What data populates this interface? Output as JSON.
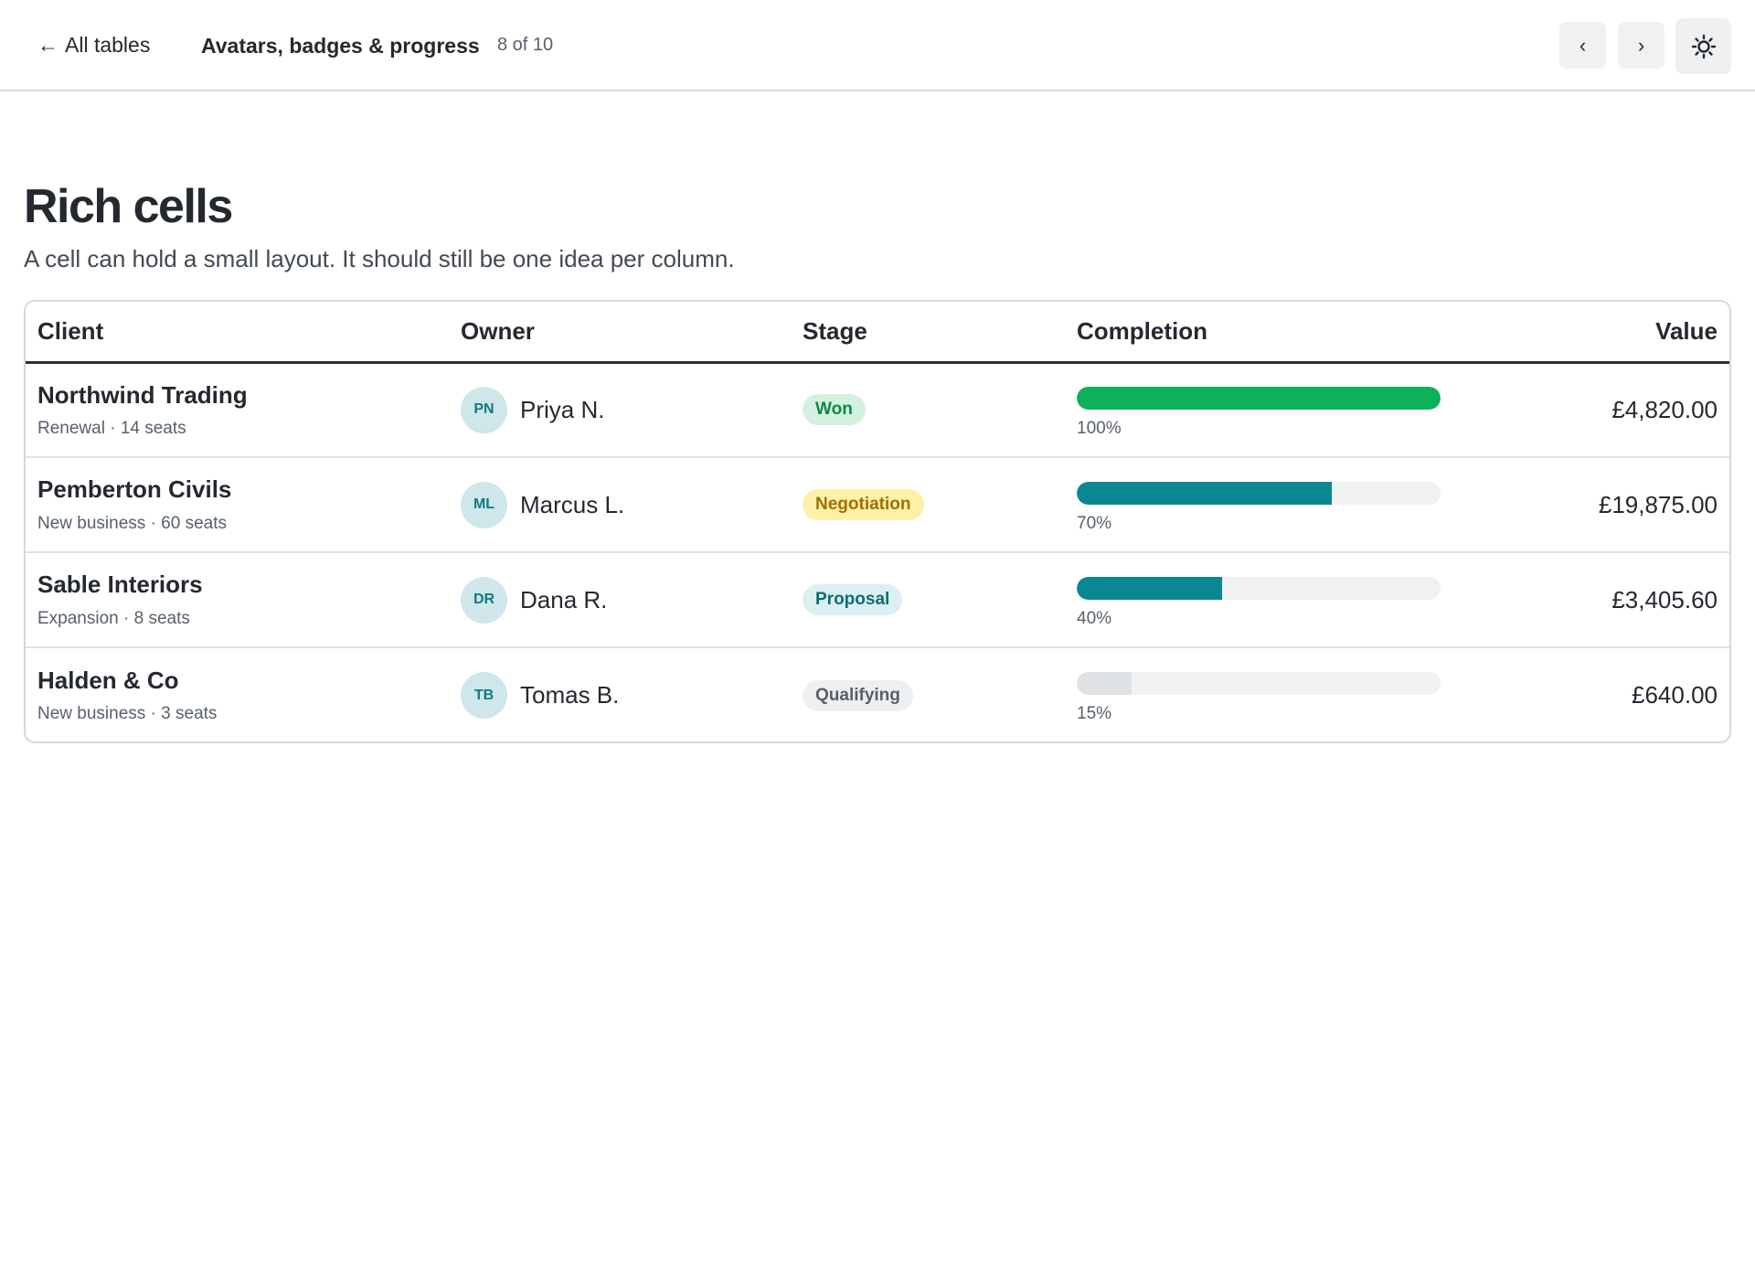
{
  "header": {
    "back_label": "All tables",
    "section_title": "Avatars, badges & progress",
    "position": "8 of 10",
    "prev_label": "‹",
    "next_label": "›"
  },
  "page": {
    "title": "Rich cells",
    "subtitle": "A cell can hold a small layout. It should still be one idea per column."
  },
  "table": {
    "columns": [
      "Client",
      "Owner",
      "Stage",
      "Completion",
      "Value"
    ],
    "rows": [
      {
        "client": "Northwind Trading",
        "meta": "Renewal · 14 seats",
        "initials": "PN",
        "owner": "Priya N.",
        "stage": "Won",
        "stage_bg": "#d4f1df",
        "stage_fg": "#0b8a44",
        "completion": 100,
        "completion_label": "100%",
        "bar_color": "#0db15a",
        "value": "£4,820.00"
      },
      {
        "client": "Pemberton Civils",
        "meta": "New business · 60 seats",
        "initials": "ML",
        "owner": "Marcus L.",
        "stage": "Negotiation",
        "stage_bg": "#fdf0a8",
        "stage_fg": "#a26f00",
        "completion": 70,
        "completion_label": "70%",
        "bar_color": "#0a8790",
        "value": "£19,875.00"
      },
      {
        "client": "Sable Interiors",
        "meta": "Expansion · 8 seats",
        "initials": "DR",
        "owner": "Dana R.",
        "stage": "Proposal",
        "stage_bg": "#dcf0f1",
        "stage_fg": "#0a6d74",
        "completion": 40,
        "completion_label": "40%",
        "bar_color": "#0a8790",
        "value": "£3,405.60"
      },
      {
        "client": "Halden & Co",
        "meta": "New business · 3 seats",
        "initials": "TB",
        "owner": "Tomas B.",
        "stage": "Qualifying",
        "stage_bg": "#eeeff0",
        "stage_fg": "#57606a",
        "completion": 15,
        "completion_label": "15%",
        "bar_color": "#dfe2e5",
        "value": "£640.00"
      }
    ]
  },
  "colors": {
    "accent_teal": "#0a8790",
    "success_green": "#0db15a",
    "border": "#d6d9dc"
  },
  "icons": {
    "back": "arrow-left-icon",
    "theme": "sun-icon"
  }
}
